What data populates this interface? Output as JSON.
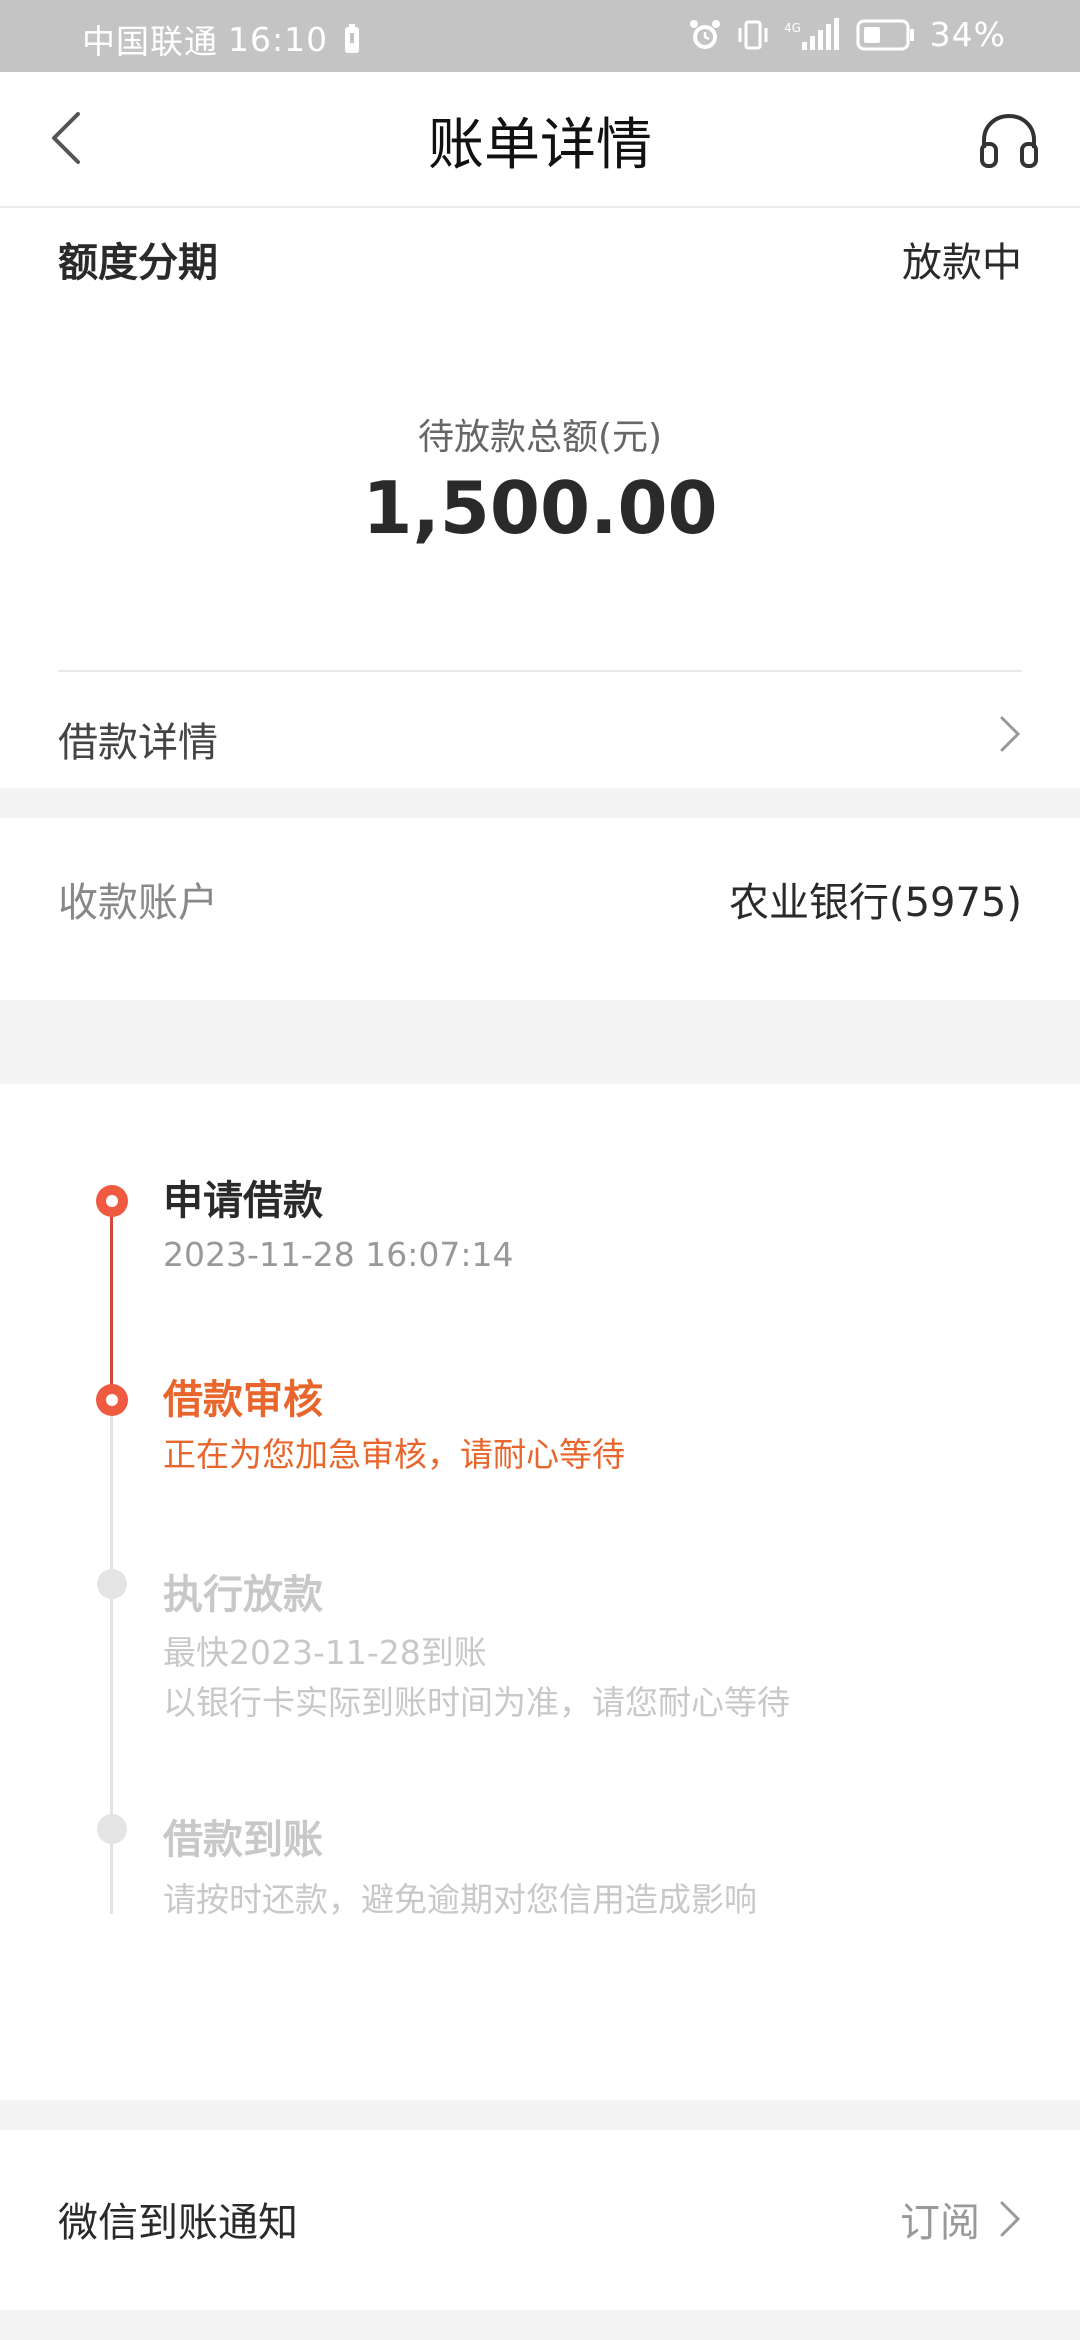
{
  "status_bar": {
    "carrier": "中国联通",
    "time": "16:10",
    "network": "4G",
    "battery": "34%"
  },
  "header": {
    "title": "账单详情",
    "back_icon": "back-arrow-icon",
    "service_icon": "headset-icon"
  },
  "summary": {
    "product": "额度分期",
    "status": "放款中",
    "amount_label": "待放款总额(元)",
    "amount": "1,500.00",
    "loan_detail_label": "借款详情"
  },
  "account": {
    "label": "收款账户",
    "value": "农业银行(5975)"
  },
  "timeline": {
    "steps": [
      {
        "title": "申请借款",
        "lines": [
          "2023-11-28 16:07:14"
        ],
        "state": "done"
      },
      {
        "title": "借款审核",
        "lines": [
          "正在为您加急审核，请耐心等待"
        ],
        "state": "current"
      },
      {
        "title": "执行放款",
        "lines": [
          "最快2023-11-28到账",
          "以银行卡实际到账时间为准，请您耐心等待"
        ],
        "state": "pending"
      },
      {
        "title": "借款到账",
        "lines": [
          "请按时还款，避免逾期对您信用造成影响"
        ],
        "state": "pending"
      }
    ]
  },
  "wechat": {
    "label": "微信到账通知",
    "action": "订阅"
  },
  "colors": {
    "accent": "#ef5a40",
    "accent_text": "#e8652c",
    "done_line": "#d9443a",
    "pending_text": "#c8c8c8"
  }
}
